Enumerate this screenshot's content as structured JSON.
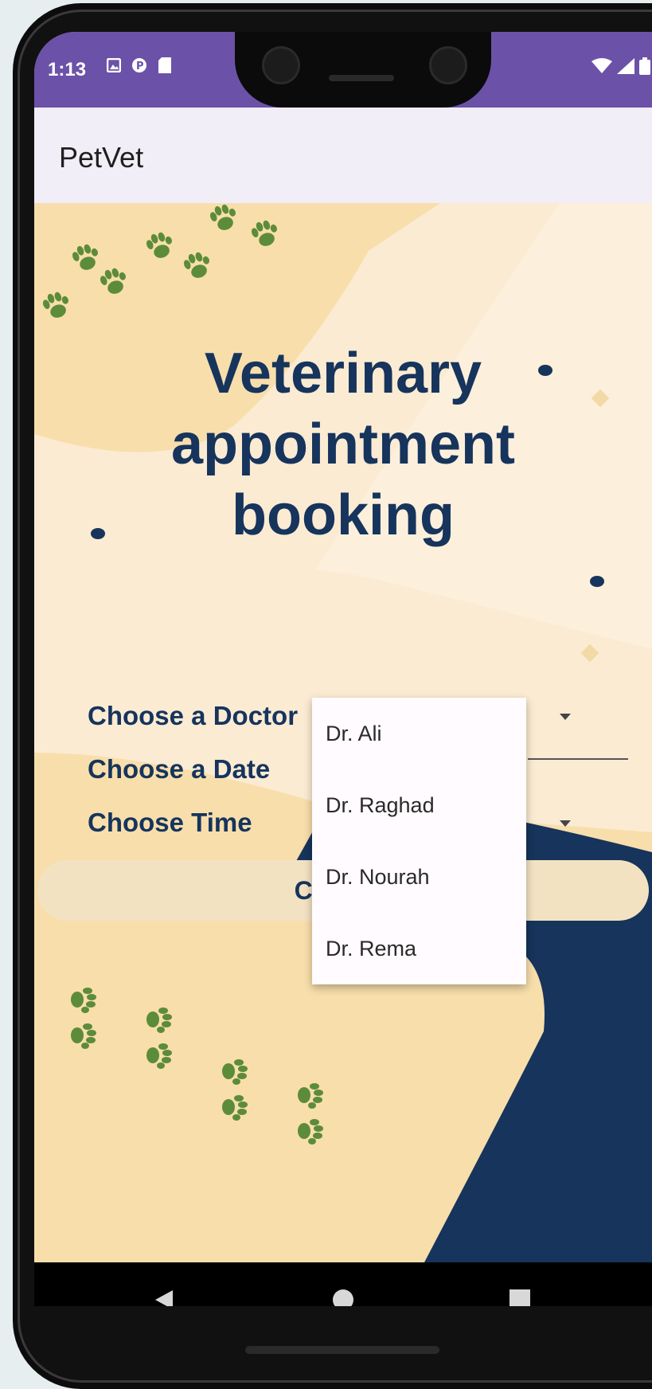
{
  "status_bar": {
    "time": "1:13",
    "left_icons": [
      "image-icon",
      "p-badge-icon",
      "sd-card-icon"
    ],
    "right_icons": [
      "wifi-icon",
      "signal-icon",
      "battery-icon"
    ]
  },
  "app_bar": {
    "title": "PetVet"
  },
  "main": {
    "heading_lines": [
      "Veterinary",
      "appointment",
      "booking"
    ],
    "doctor_label": "Choose a Doctor",
    "date_label": "Choose a Date",
    "time_label": "Choose Time",
    "confirm_label": "Confirm"
  },
  "doctor_dropdown": {
    "options": [
      "Dr. Ali",
      "Dr. Raghad",
      "Dr. Nourah",
      "Dr. Rema"
    ]
  },
  "navigation": {
    "icons": [
      "back-icon",
      "home-icon",
      "recents-icon"
    ]
  },
  "colors": {
    "status_bar": "#6b52a8",
    "app_bar": "#f2eef7",
    "heading": "#16345c",
    "background_peach": "#f8deab",
    "background_cream": "#fbebd3",
    "navy": "#16345c",
    "paw_green": "#5c8c3a"
  }
}
